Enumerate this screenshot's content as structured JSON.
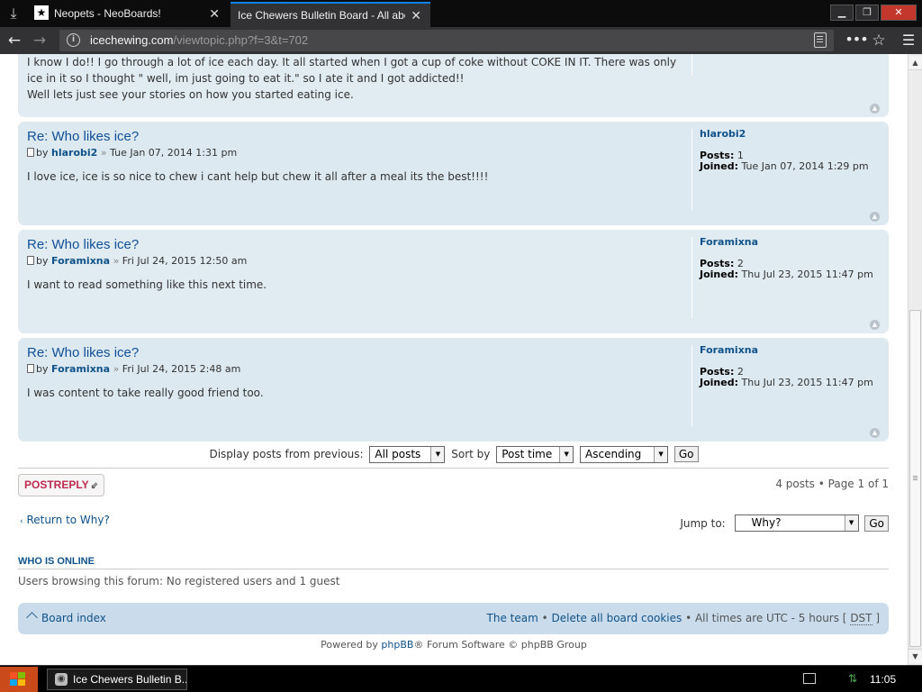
{
  "browser": {
    "tabs": [
      {
        "title": "Neopets - NeoBoards!",
        "active": false,
        "icon": "neopets-star-icon"
      },
      {
        "title": "Ice Chewers Bulletin Board - All about c",
        "active": true
      }
    ],
    "url_domain": "icechewing.com",
    "url_path": "/viewtopic.php?f=3&t=702",
    "accent_color": "#0a84ff"
  },
  "first_post": {
    "lines": [
      "I know I do!! I go through a lot of ice each day. It all started when I got a cup of coke without COKE IN IT. There was only",
      "ice in it so I thought \" well, im just going to eat it.\" so I ate it and I got addicted!!",
      "Well lets just see your stories on how you started eating ice."
    ]
  },
  "posts": [
    {
      "title": "Re: Who likes ice?",
      "by": "by",
      "author": "hlarobi2",
      "sep": "»",
      "date": "Tue Jan 07, 2014 1:31 pm",
      "content": "I love ice, ice is so nice to chew i cant help but chew it all after a meal its the best!!!!",
      "profile_name": "hlarobi2",
      "posts_label": "Posts:",
      "posts_count": "1",
      "joined_label": "Joined:",
      "joined_date": "Tue Jan 07, 2014 1:29 pm"
    },
    {
      "title": "Re: Who likes ice?",
      "by": "by",
      "author": "Foramixna",
      "sep": "»",
      "date": "Fri Jul 24, 2015 12:50 am",
      "content": "I want to read something like this next time.",
      "profile_name": "Foramixna",
      "posts_label": "Posts:",
      "posts_count": "2",
      "joined_label": "Joined:",
      "joined_date": "Thu Jul 23, 2015 11:47 pm"
    },
    {
      "title": "Re: Who likes ice?",
      "by": "by",
      "author": "Foramixna",
      "sep": "»",
      "date": "Fri Jul 24, 2015 2:48 am",
      "content": "I was content to take really good friend too.",
      "profile_name": "Foramixna",
      "posts_label": "Posts:",
      "posts_count": "2",
      "joined_label": "Joined:",
      "joined_date": "Thu Jul 23, 2015 11:47 pm"
    }
  ],
  "display_options": {
    "display_label": "Display posts from previous:",
    "display_value": "All posts",
    "sort_label": "Sort by",
    "sort_value": "Post time",
    "order_value": "Ascending",
    "go_label": "Go"
  },
  "post_reply": {
    "label": "POSTREPLY"
  },
  "pagination": {
    "text": "4 posts • Page ",
    "current": "1",
    "of": " of ",
    "total": "1"
  },
  "return_link": "Return to Why?",
  "jump_to": {
    "label": "Jump to:",
    "value": "Why?",
    "go_label": "Go"
  },
  "who_is_online": {
    "heading": "WHO IS ONLINE",
    "text": "Users browsing this forum: No registered users and 1 guest"
  },
  "footer": {
    "board_index": "Board index",
    "team": "The team",
    "bullet": " • ",
    "delete_cookies": "Delete all board cookies",
    "timezone_prefix": "All times are UTC - 5 hours [ ",
    "dst": "DST",
    "timezone_suffix": " ]",
    "powered_prefix": "Powered by ",
    "phpbb": "phpBB",
    "powered_suffix": "® Forum Software © phpBB Group"
  },
  "taskbar": {
    "task_title": "Ice Chewers Bulletin B...",
    "clock": "11:05 AM"
  }
}
